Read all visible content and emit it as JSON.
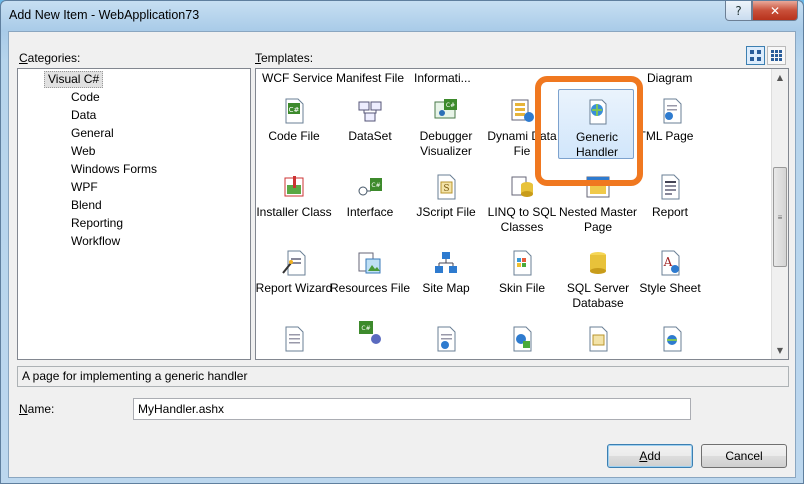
{
  "window": {
    "title": "Add New Item - WebApplication73",
    "help_glyph": "?",
    "close_glyph": "✕"
  },
  "categories": {
    "label_prefix": "C",
    "label_rest": "ategories:",
    "items": [
      {
        "label": "Visual C#"
      },
      {
        "label": "Code"
      },
      {
        "label": "Data"
      },
      {
        "label": "General"
      },
      {
        "label": "Web"
      },
      {
        "label": "Windows Forms"
      },
      {
        "label": "WPF"
      },
      {
        "label": "Blend"
      },
      {
        "label": "Reporting"
      },
      {
        "label": "Workflow"
      }
    ]
  },
  "templates": {
    "label_prefix": "T",
    "label_rest": "emplates:",
    "top_row_partial": [
      "WCF Service",
      "Manifest File",
      "Informati...",
      "Diagram"
    ],
    "items": [
      {
        "label": "Code File",
        "icon": "code-file-icon"
      },
      {
        "label": "DataSet",
        "icon": "dataset-icon"
      },
      {
        "label": "Debugger Visualizer",
        "icon": "debugger-visualizer-icon"
      },
      {
        "label": "Dynami Data Fie",
        "icon": "dynamic-data-field-icon"
      },
      {
        "label": "Generic Handler",
        "icon": "generic-handler-icon"
      },
      {
        "label": "TML Page",
        "icon": "html-page-icon"
      },
      {
        "label": "Installer Class",
        "icon": "installer-class-icon"
      },
      {
        "label": "Interface",
        "icon": "interface-icon"
      },
      {
        "label": "JScript File",
        "icon": "jscript-file-icon"
      },
      {
        "label": "LINQ to SQL Classes",
        "icon": "linq-to-sql-icon"
      },
      {
        "label": "Nested Master Page",
        "icon": "nested-master-page-icon"
      },
      {
        "label": "Report",
        "icon": "report-icon"
      },
      {
        "label": "Report Wizard",
        "icon": "report-wizard-icon"
      },
      {
        "label": "Resources File",
        "icon": "resources-file-icon"
      },
      {
        "label": "Site Map",
        "icon": "site-map-icon"
      },
      {
        "label": "Skin File",
        "icon": "skin-file-icon"
      },
      {
        "label": "SQL Server Database",
        "icon": "sql-database-icon"
      },
      {
        "label": "Style Sheet",
        "icon": "style-sheet-icon"
      }
    ],
    "selected": "Generic Handler"
  },
  "description": "A page for implementing a generic handler",
  "name_field": {
    "label_prefix": "N",
    "label_rest": "ame:",
    "value": "MyHandler.ashx"
  },
  "buttons": {
    "add_prefix": "A",
    "add_rest": "dd",
    "cancel": "Cancel"
  },
  "colors": {
    "highlight": "#f07820",
    "selection": "#d1e6fb"
  }
}
